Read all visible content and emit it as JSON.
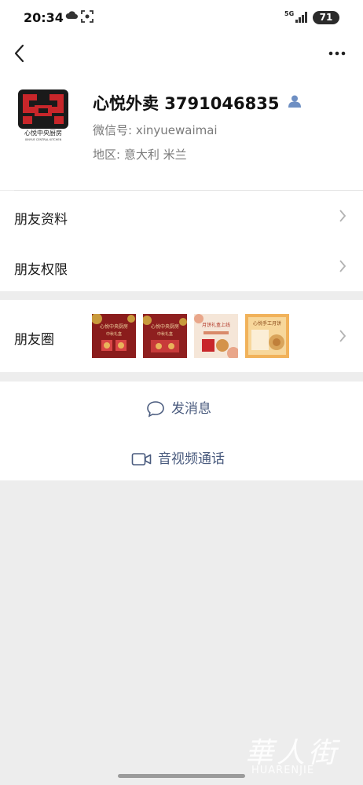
{
  "status_bar": {
    "time": "20:34",
    "network": "5G",
    "battery": "71"
  },
  "profile": {
    "name": "心悦外卖 3791046835",
    "wechat_id": "微信号: xinyuewaimai",
    "region": "地区: 意大利  米兰",
    "avatar_caption": "心悦中央厨房",
    "avatar_subcaption": "XINYUE CENTRAL KITCHEN"
  },
  "menu": {
    "friend_info": "朋友资料",
    "friend_permissions": "朋友权限",
    "moments": "朋友圈"
  },
  "moments_thumbs": [
    {
      "title": "心悦中央厨房",
      "subtitle": "中秋礼盒"
    },
    {
      "title": "心悦中央厨房",
      "subtitle": "中秋礼盒"
    },
    {
      "title": "月饼礼盒上线",
      "subtitle": ""
    },
    {
      "title": "心悦手工月饼",
      "subtitle": ""
    }
  ],
  "actions": {
    "send_message": "发消息",
    "av_call": "音视频通话"
  },
  "watermark": {
    "cn": "華人街",
    "en": "HUARENJIE"
  },
  "colors": {
    "link_blue": "#4a5b7e",
    "avatar_red": "#c8262a",
    "avatar_black": "#1a1a1a",
    "background": "#ededed"
  }
}
